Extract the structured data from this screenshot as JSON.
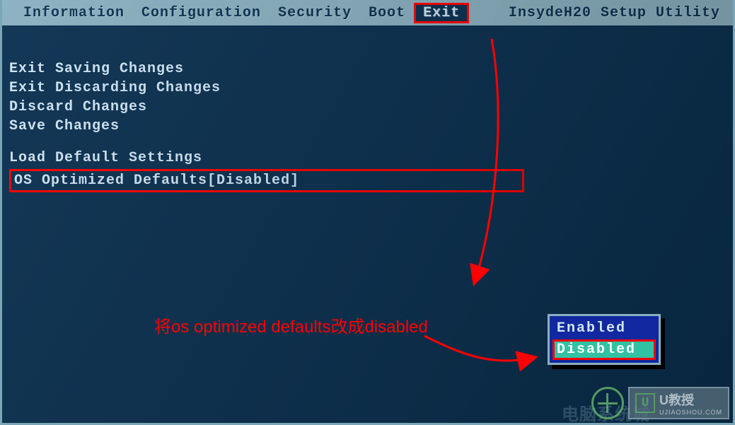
{
  "brand": "InsydeH20 Setup Utility",
  "tabs": [
    {
      "label": "Information",
      "selected": false
    },
    {
      "label": "Configuration",
      "selected": false
    },
    {
      "label": "Security",
      "selected": false
    },
    {
      "label": "Boot",
      "selected": false
    },
    {
      "label": "Exit",
      "selected": true
    }
  ],
  "exit_menu": {
    "items": [
      "Exit Saving Changes",
      "Exit Discarding Changes",
      "Discard Changes",
      "Save Changes"
    ],
    "load_defaults": "Load Default Settings",
    "os_opt": {
      "label": "OS Optimized Defaults",
      "value": "[Disabled]"
    }
  },
  "popup": {
    "options": [
      "Enabled",
      "Disabled"
    ],
    "selected": "Disabled"
  },
  "annotation": {
    "text": "将os optimized defaults改成disabled"
  },
  "watermark": {
    "brand1_css": "电脑系统城",
    "brand2": "U教授",
    "brand2_sub": "UJIAOSHOU.COM"
  }
}
